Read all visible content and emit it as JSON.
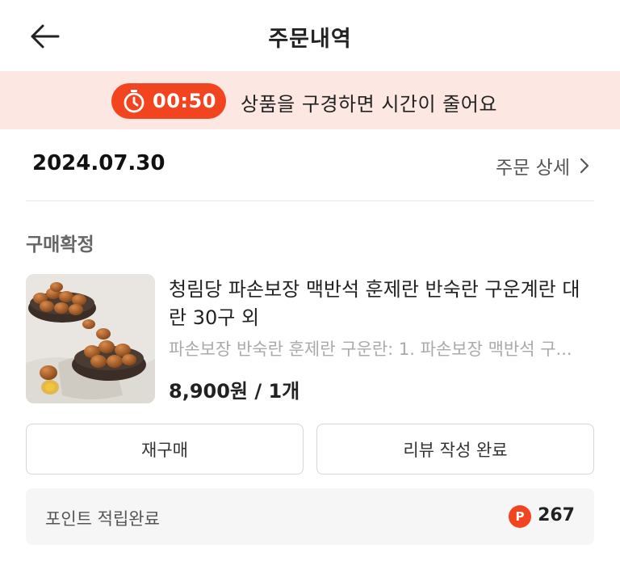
{
  "header": {
    "back_icon": "arrow-left-icon",
    "title": "주문내역"
  },
  "timer_banner": {
    "timer_icon": "stopwatch-icon",
    "time": "00:50",
    "message": "상품을 구경하면 시간이 줄어요",
    "accent_color": "#f2451f",
    "background_color": "#fde7e3"
  },
  "order": {
    "date": "2024.07.30",
    "detail_link": "주문 상세",
    "detail_icon": "chevron-right-icon",
    "status": "구매확정",
    "product": {
      "image": "eggs-product-image",
      "name": "청림당 파손보장 맥반석 훈제란 반숙란 구운계란 대란 30구 외",
      "option": "파손보장 반숙란 훈제란 구운란: 1. 파손보장 맥반석 구...",
      "price": "8,900원 / 1개"
    },
    "buttons": {
      "rebuy": "재구매",
      "review": "리뷰 작성 완료"
    },
    "points": {
      "label": "포인트 적립완료",
      "badge": "P",
      "value": "267"
    }
  }
}
